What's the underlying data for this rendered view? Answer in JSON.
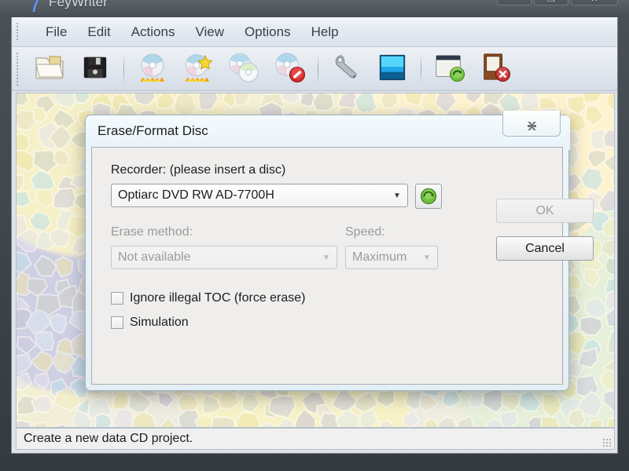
{
  "window": {
    "title": "FeyWriter",
    "icon": "feather-icon",
    "controls": [
      {
        "name": "minimize-button",
        "glyph": "—"
      },
      {
        "name": "maximize-button",
        "glyph": "❐"
      },
      {
        "name": "close-button",
        "glyph": "✕"
      }
    ]
  },
  "menubar": {
    "items": [
      {
        "label": "File"
      },
      {
        "label": "Edit"
      },
      {
        "label": "Actions"
      },
      {
        "label": "View"
      },
      {
        "label": "Options"
      },
      {
        "label": "Help"
      }
    ]
  },
  "toolbar": {
    "items": [
      {
        "name": "open-project-button",
        "icon": "open-folder-icon"
      },
      {
        "name": "save-project-button",
        "icon": "floppy-disk-icon"
      },
      {
        "name": "separator-1",
        "icon": "separator"
      },
      {
        "name": "burn-disc-button",
        "icon": "burn-disc-icon"
      },
      {
        "name": "burn-image-button",
        "icon": "burn-disc-star-icon"
      },
      {
        "name": "copy-disc-button",
        "icon": "copy-disc-icon"
      },
      {
        "name": "erase-disc-button",
        "icon": "erase-disc-icon"
      },
      {
        "name": "separator-2",
        "icon": "separator"
      },
      {
        "name": "settings-button",
        "icon": "wrench-icon"
      },
      {
        "name": "cover-editor-button",
        "icon": "blue-panel-icon"
      },
      {
        "name": "separator-3",
        "icon": "separator"
      },
      {
        "name": "refresh-window-button",
        "icon": "window-refresh-icon"
      },
      {
        "name": "exit-button",
        "icon": "exit-door-icon"
      }
    ]
  },
  "statusbar": {
    "text": "Create a new data CD project."
  },
  "dialog": {
    "title": "Erase/Format Disc",
    "close_glyph": "✖",
    "recorder": {
      "label": "Recorder: (please insert a disc)",
      "value": "Optiarc DVD RW AD-7700H",
      "arrow": "▼",
      "refresh_icon": "green-refresh-icon"
    },
    "erase_method": {
      "label": "Erase method:",
      "value": "Not available",
      "arrow": "▼",
      "enabled": false
    },
    "speed": {
      "label": "Speed:",
      "value": "Maximum",
      "arrow": "▼",
      "enabled": false
    },
    "checkboxes": [
      {
        "label": "Ignore illegal TOC (force erase)",
        "checked": false
      },
      {
        "label": "Simulation",
        "checked": false
      }
    ],
    "buttons": {
      "ok": "OK",
      "cancel": "Cancel"
    }
  },
  "colors": {
    "accent_green": "#5fa832",
    "dialog_body": "#efeeec",
    "aero_frame": "#e9f2f8"
  }
}
